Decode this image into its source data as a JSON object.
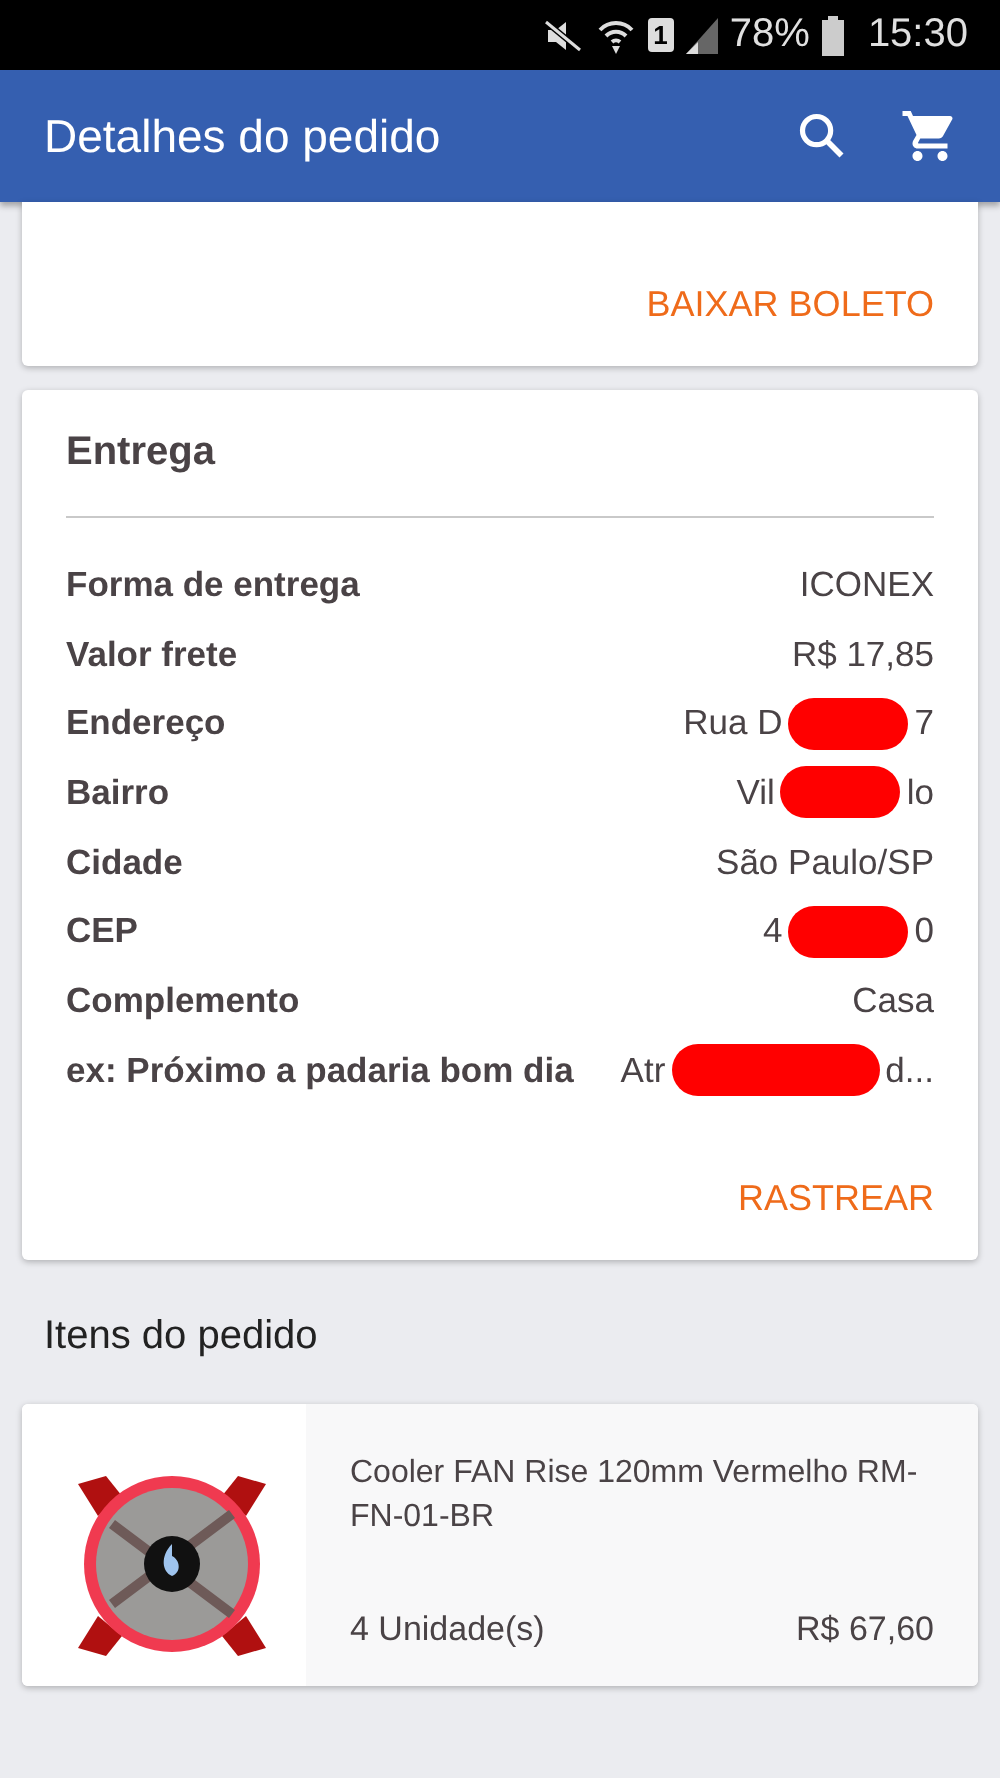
{
  "status_bar": {
    "sim": "1",
    "battery": "78%",
    "time": "15:30"
  },
  "app_bar": {
    "title": "Detalhes do pedido"
  },
  "payment_card": {
    "action": "BAIXAR BOLETO"
  },
  "delivery": {
    "title": "Entrega",
    "rows": [
      {
        "label": "Forma de entrega",
        "value": "ICONEX"
      },
      {
        "label": "Valor frete",
        "value": "R$ 17,85"
      },
      {
        "label": "Endereço",
        "value_start": "Rua D",
        "value_end": "7"
      },
      {
        "label": "Bairro",
        "value_start": "Vil",
        "value_end": "lo"
      },
      {
        "label": "Cidade",
        "value": "São Paulo/SP"
      },
      {
        "label": "CEP",
        "value_start": "4",
        "value_end": "0"
      },
      {
        "label": "Complemento",
        "value": "Casa"
      },
      {
        "label": "ex: Próximo a padaria bom dia",
        "value_start": "Atr",
        "value_end": "d..."
      }
    ],
    "action": "RASTREAR"
  },
  "items_title": "Itens do pedido",
  "items": [
    {
      "kind": "picture",
      "name": "Cooler FAN Rise 120mm Vermelho RM-FN-01-BR",
      "quantity": "4 Unidade(s)",
      "price": "R$ 67,60"
    }
  ]
}
